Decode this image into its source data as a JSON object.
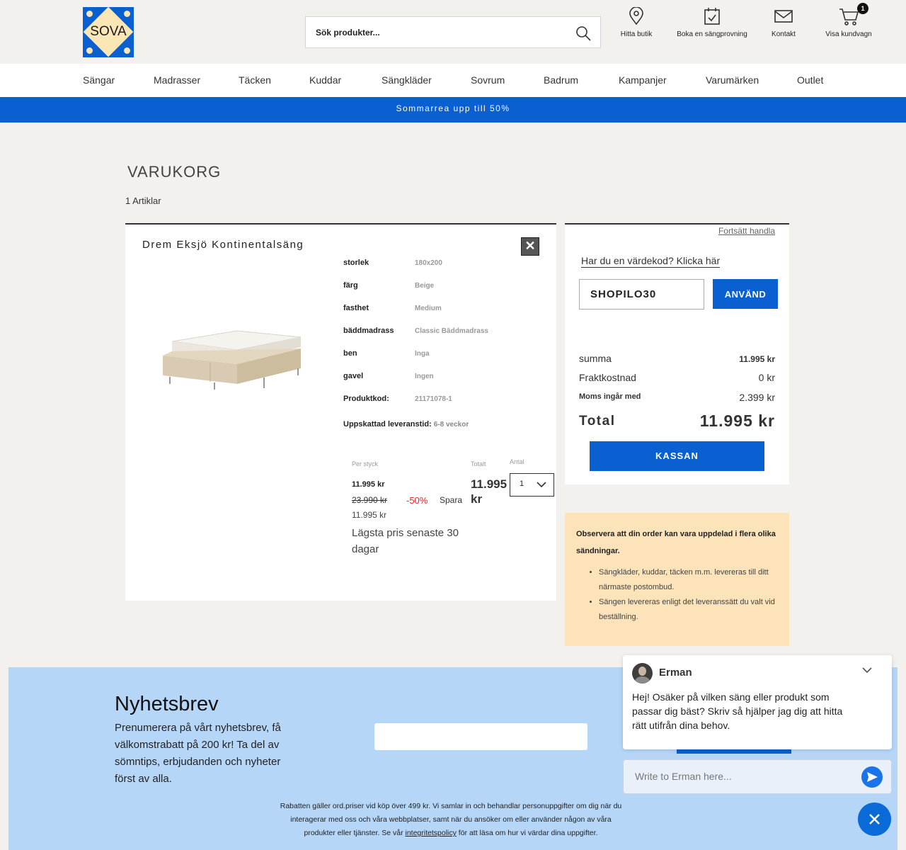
{
  "brand": {
    "logo_text": "SOVA",
    "accent": "#0a5fd1",
    "logo_bg": "#fbe6b6"
  },
  "search": {
    "placeholder": "Sök produkter..."
  },
  "header_links": {
    "store": "Hitta butik",
    "booking": "Boka en sängprovning",
    "contact": "Kontakt",
    "cart": "Visa kundvagn",
    "cart_count": "1"
  },
  "nav": [
    "Sängar",
    "Madrasser",
    "Täcken",
    "Kuddar",
    "Sängkläder",
    "Sovrum",
    "Badrum",
    "Kampanjer",
    "Varumärken",
    "Outlet"
  ],
  "promo": "Sommarrea upp till 50%",
  "cart": {
    "title": "VARUKORG",
    "count": "1 Artiklar",
    "item": {
      "name": "Drem Eksjö Kontinentalsäng",
      "remove_icon": "close-icon",
      "attributes": [
        {
          "label": "storlek",
          "value": "180x200"
        },
        {
          "label": "färg",
          "value": "Beige"
        },
        {
          "label": "fasthet",
          "value": "Medium"
        },
        {
          "label": "bäddmadrass",
          "value": "Classic Bäddmadrass"
        },
        {
          "label": "ben",
          "value": "Inga"
        },
        {
          "label": "gavel",
          "value": "Ingen"
        },
        {
          "label": "Produktkod:",
          "value": "21171078-1"
        }
      ],
      "lead_label": "Uppskattad leveranstid:",
      "lead_value": "6-8 veckor",
      "per_item_label": "Per styck",
      "total_label": "Totalt",
      "qty_label": "Antal",
      "price_now": "11.995 kr",
      "price_old": "23.990 kr",
      "discount": "-50%",
      "save_label": "Spara",
      "save_amount": "11.995 kr",
      "lowest_note": "Lägsta pris senaste 30 dagar",
      "total_price": "11.995 kr",
      "qty": "1"
    }
  },
  "summary": {
    "continue": "Fortsätt handla",
    "voucher_link": "Har du en värdekod? Klicka här",
    "voucher_code": "SHOPILO30",
    "apply": "ANVÄND",
    "subtotal_label": "summa",
    "subtotal": "11.995 kr",
    "shipping_label": "Fraktkostnad",
    "shipping": "0 kr",
    "vat_label": "Moms ingår med",
    "vat": "2.399 kr",
    "total_label": "Total",
    "total": "11.995 kr",
    "checkout": "KASSAN"
  },
  "notice": {
    "heading": "Observera att din order kan vara uppdelad i flera olika sändningar.",
    "items": [
      "Sängkläder, kuddar, täcken m.m. levereras till ditt närmaste postombud.",
      "Sängen levereras enligt det leveranssätt du valt vid beställning."
    ]
  },
  "newsletter": {
    "title": "Nyhetsbrev",
    "text": "Prenumerera på vårt nyhetsbrev, få välkomstrabatt på 200 kr! Ta del av sömntips, erbjudanden och nyheter först av alla.",
    "legal_pre": "Rabatten gäller ord.priser vid köp över 499 kr. Vi samlar in och behandlar personuppgifter om dig när du interagerar med oss och våra webbplatser, samt när du ansöker om eller använder någon av våra produkter eller tjänster. Se vår",
    "legal_link": "integritetspolicy",
    "legal_post": "för att läsa om hur vi värdar dina uppgifter."
  },
  "chat": {
    "agent": "Erman",
    "message": "Hej! Osäker på vilken säng eller produkt som passar dig bäst? Skriv så hjälper jag dig att hitta rätt utifrån dina behov.",
    "placeholder": "Write to Erman here..."
  }
}
